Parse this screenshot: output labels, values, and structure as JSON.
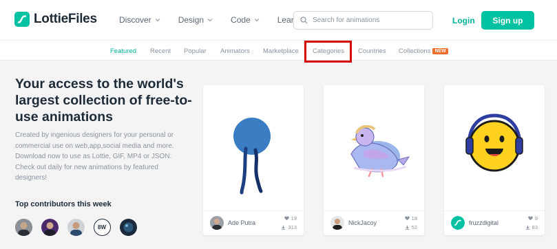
{
  "header": {
    "logo_text": "LottieFiles",
    "nav": [
      {
        "label": "Discover"
      },
      {
        "label": "Design"
      },
      {
        "label": "Code"
      },
      {
        "label": "Learn"
      }
    ],
    "search_placeholder": "Search for animations",
    "login_label": "Login",
    "signup_label": "Sign up"
  },
  "subnav": {
    "items": [
      {
        "label": "Featured",
        "active": true
      },
      {
        "label": "Recent"
      },
      {
        "label": "Popular"
      },
      {
        "label": "Animators"
      },
      {
        "label": "Marketplace"
      },
      {
        "label": "Categories",
        "highlighted": true
      },
      {
        "label": "Countries"
      },
      {
        "label": "Collections"
      }
    ],
    "new_badge": "NEW"
  },
  "hero": {
    "title": "Your access to the world's largest collection of free-to-use animations",
    "description": "Created by ingenious designers for your personal or commercial use on web,app,social media and more. Download now to use as Lottie, GIF, MP4 or JSON. Check out daily for new animations by featured designers!",
    "contributors_title": "Top contributors this week"
  },
  "cards": [
    {
      "author": "Ade Putra",
      "likes": "19",
      "downloads": "313"
    },
    {
      "author": "NickJacoy",
      "likes": "18",
      "downloads": "52"
    },
    {
      "author": "fruzzdigital",
      "likes": "9",
      "downloads": "83"
    }
  ],
  "colors": {
    "brand": "#00c1a2",
    "highlight": "#d40000",
    "new_badge": "#f06c2b"
  }
}
